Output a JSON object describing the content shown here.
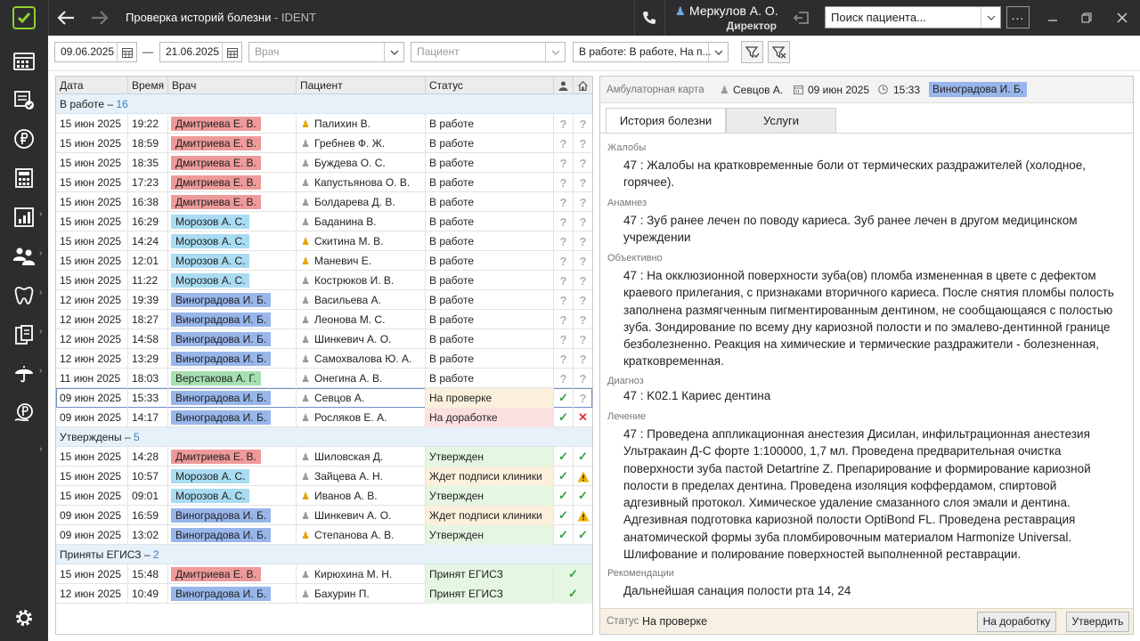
{
  "window": {
    "title": "Проверка историй болезни",
    "app_name": "- IDENT",
    "user_name": "Меркулов А. О.",
    "user_role": "Директор",
    "search_placeholder": "Поиск пациента...",
    "colors": {
      "titlebar": "#2d2d30",
      "sidebar": "#2d2d30",
      "logo": "#8fd12e"
    }
  },
  "sidebar": {
    "items": [
      {
        "icon": "schedule-icon"
      },
      {
        "icon": "tasks-icon"
      },
      {
        "icon": "ruble-icon"
      },
      {
        "icon": "calculator-icon"
      },
      {
        "icon": "reports-icon"
      },
      {
        "icon": "patients-icon"
      },
      {
        "icon": "tooth-icon"
      },
      {
        "icon": "documents-icon"
      },
      {
        "icon": "insurance-icon"
      },
      {
        "icon": "payments-icon"
      },
      {
        "icon": "settings-icon"
      }
    ]
  },
  "filters": {
    "date_from": "09.06.2025",
    "date_to": "21.06.2025",
    "dash": "—",
    "doctor_placeholder": "Врач",
    "patient_placeholder": "Пациент",
    "status_value": "В работе: В работе, На п..."
  },
  "grid": {
    "columns": [
      "Дата",
      "Время",
      "Врач",
      "Пациент",
      "Статус"
    ],
    "groups": [
      {
        "label": "В работе –",
        "count": "16",
        "rows": [
          {
            "date": "15 июн 2025",
            "time": "19:22",
            "doctor": "Дмитриева Е. В.",
            "dc": "red",
            "pi": "gold",
            "patient": "Палихин В.",
            "status": "В работе",
            "sc": "",
            "a": "q",
            "b": "q"
          },
          {
            "date": "15 июн 2025",
            "time": "18:59",
            "doctor": "Дмитриева Е. В.",
            "dc": "red",
            "pi": "gray",
            "patient": "Гребнев Ф. Ж.",
            "status": "В работе",
            "sc": "",
            "a": "q",
            "b": "q"
          },
          {
            "date": "15 июн 2025",
            "time": "18:35",
            "doctor": "Дмитриева Е. В.",
            "dc": "red",
            "pi": "gray",
            "patient": "Буждева О. С.",
            "status": "В работе",
            "sc": "",
            "a": "q",
            "b": "q"
          },
          {
            "date": "15 июн 2025",
            "time": "17:23",
            "doctor": "Дмитриева Е. В.",
            "dc": "red",
            "pi": "gray",
            "patient": "Капустьянова О. В.",
            "status": "В работе",
            "sc": "",
            "a": "q",
            "b": "q"
          },
          {
            "date": "15 июн 2025",
            "time": "16:38",
            "doctor": "Дмитриева Е. В.",
            "dc": "red",
            "pi": "gray",
            "patient": "Болдарева Д. В.",
            "status": "В работе",
            "sc": "",
            "a": "q",
            "b": "q"
          },
          {
            "date": "15 июн 2025",
            "time": "16:29",
            "doctor": "Морозов А. С.",
            "dc": "cyan",
            "pi": "gray",
            "patient": "Баданина В.",
            "status": "В работе",
            "sc": "",
            "a": "q",
            "b": "q"
          },
          {
            "date": "15 июн 2025",
            "time": "14:24",
            "doctor": "Морозов А. С.",
            "dc": "cyan",
            "pi": "gold",
            "patient": "Скитина М. В.",
            "status": "В работе",
            "sc": "",
            "a": "q",
            "b": "q"
          },
          {
            "date": "15 июн 2025",
            "time": "12:01",
            "doctor": "Морозов А. С.",
            "dc": "cyan",
            "pi": "gold",
            "patient": "Маневич Е.",
            "status": "В работе",
            "sc": "",
            "a": "q",
            "b": "q"
          },
          {
            "date": "15 июн 2025",
            "time": "11:22",
            "doctor": "Морозов А. С.",
            "dc": "cyan",
            "pi": "gray",
            "patient": "Кострюков И. В.",
            "status": "В работе",
            "sc": "",
            "a": "q",
            "b": "q"
          },
          {
            "date": "12 июн 2025",
            "time": "19:39",
            "doctor": "Виноградова И. Б.",
            "dc": "blue",
            "pi": "gray",
            "patient": "Васильева А.",
            "status": "В работе",
            "sc": "",
            "a": "q",
            "b": "q"
          },
          {
            "date": "12 июн 2025",
            "time": "18:27",
            "doctor": "Виноградова И. Б.",
            "dc": "blue",
            "pi": "gray",
            "patient": "Леонова М. С.",
            "status": "В работе",
            "sc": "",
            "a": "q",
            "b": "q"
          },
          {
            "date": "12 июн 2025",
            "time": "14:58",
            "doctor": "Виноградова И. Б.",
            "dc": "blue",
            "pi": "gray",
            "patient": "Шинкевич А. О.",
            "status": "В работе",
            "sc": "",
            "a": "q",
            "b": "q"
          },
          {
            "date": "12 июн 2025",
            "time": "13:29",
            "doctor": "Виноградова И. Б.",
            "dc": "blue",
            "pi": "gray",
            "patient": "Самохвалова Ю. А.",
            "status": "В работе",
            "sc": "",
            "a": "q",
            "b": "q"
          },
          {
            "date": "11 июн 2025",
            "time": "18:03",
            "doctor": "Верстакова А. Г.",
            "dc": "green",
            "pi": "gray",
            "patient": "Онегина А. В.",
            "status": "В работе",
            "sc": "",
            "a": "q",
            "b": "q"
          },
          {
            "date": "09 июн 2025",
            "time": "15:33",
            "doctor": "Виноградова И. Б.",
            "dc": "blue",
            "pi": "gray",
            "patient": "Севцов А.",
            "status": "На проверке",
            "sc": "beige",
            "a": "ok",
            "b": "q",
            "selected": true
          },
          {
            "date": "09 июн 2025",
            "time": "14:17",
            "doctor": "Виноградова И. Б.",
            "dc": "blue",
            "pi": "gray",
            "patient": "Росляков Е. А.",
            "status": "На доработке",
            "sc": "pink",
            "a": "ok",
            "b": "no"
          }
        ]
      },
      {
        "label": "Утверждены –",
        "count": "5",
        "rows": [
          {
            "date": "15 июн 2025",
            "time": "14:28",
            "doctor": "Дмитриева Е. В.",
            "dc": "red",
            "pi": "gray",
            "patient": "Шиловская Д.",
            "status": "Утвержден",
            "sc": "lgreen",
            "a": "ok",
            "b": "ok"
          },
          {
            "date": "15 июн 2025",
            "time": "10:57",
            "doctor": "Морозов А. С.",
            "dc": "cyan",
            "pi": "gray",
            "patient": "Зайцева А. Н.",
            "status": "Ждет подписи клиники",
            "sc": "beige",
            "a": "ok",
            "b": "warn"
          },
          {
            "date": "15 июн 2025",
            "time": "09:01",
            "doctor": "Морозов А. С.",
            "dc": "cyan",
            "pi": "gold",
            "patient": "Иванов А. В.",
            "status": "Утвержден",
            "sc": "lgreen",
            "a": "ok",
            "b": "ok"
          },
          {
            "date": "09 июн 2025",
            "time": "16:59",
            "doctor": "Виноградова И. Б.",
            "dc": "blue",
            "pi": "gray",
            "patient": "Шинкевич А. О.",
            "status": "Ждет подписи клиники",
            "sc": "beige",
            "a": "ok",
            "b": "warn"
          },
          {
            "date": "09 июн 2025",
            "time": "13:02",
            "doctor": "Виноградова И. Б.",
            "dc": "blue",
            "pi": "gold",
            "patient": "Степанова А. В.",
            "status": "Утвержден",
            "sc": "lgreen",
            "a": "ok",
            "b": "ok"
          }
        ]
      },
      {
        "label": "Приняты ЕГИСЗ –",
        "count": "2",
        "rows": [
          {
            "date": "15 июн 2025",
            "time": "15:48",
            "doctor": "Дмитриева Е. В.",
            "dc": "red",
            "pi": "gray",
            "patient": "Кирюхина М. Н.",
            "status": "Принят ЕГИСЗ",
            "sc": "lgreen",
            "a": "ok",
            "b": ""
          },
          {
            "date": "12 июн 2025",
            "time": "10:49",
            "doctor": "Виноградова И. Б.",
            "dc": "blue",
            "pi": "gray",
            "patient": "Бахурин П.",
            "status": "Принят ЕГИСЗ",
            "sc": "lgreen",
            "a": "ok",
            "b": ""
          }
        ]
      }
    ],
    "colors": {
      "red": "#ef9a9a",
      "cyan": "#a9dcf2",
      "blue": "#98b6ea",
      "green": "#a6dfb0",
      "beige": "#faf0dc",
      "pink": "#fbe1e1",
      "lgreen": "#e5f6e2"
    }
  },
  "card": {
    "label": "Амбулаторная карта",
    "patient": "Севцов А.",
    "date": "09 июн 2025",
    "time": "15:33",
    "doctor": "Виноградова И. Б.",
    "tabs": [
      "История болезни",
      "Услуги"
    ],
    "sections": [
      {
        "label": "Жалобы",
        "text": "47 : Жалобы на кратковременные боли от термических раздражителей (холодное, горячее)."
      },
      {
        "label": "Анамнез",
        "text": "47 : Зуб ранее лечен по поводу кариеса. Зуб ранее лечен в другом медицинском учреждении"
      },
      {
        "label": "Объективно",
        "text": "47 : На окклюзионной поверхности зуба(ов) пломба измененная в цвете с дефектом краевого прилегания, с признаками вторичного кариеса. После снятия пломбы полость заполнена размягченным пигментированным дентином, не сообщающаяся с полостью зуба. Зондирование по всему дну кариозной полости и по эмалево-дентинной границе безболезненно. Реакция на химические и термические раздражители - болезненная, кратковременная."
      },
      {
        "label": "Диагноз",
        "text": "47 : K02.1 Кариес дентина"
      },
      {
        "label": "Лечение",
        "text": "47 : Проведена аппликационная анестезия Дисилан, инфильтрационная анестезия Ультракаин Д-С  форте 1:100000, 1,7 мл. Проведена предварительная очистка поверхности зуба пастой Detartrine Z. Препарирование и формирование кариозной полости в пределах дентина. Проведена изоляция коффердамом, спиртовой адгезивный протокол. Химическое удаление смазанного слоя эмали и дентина. Адгезивная подготовка кариозной полости OptiBond FL. Проведена реставрация анатомической формы зуба пломбировочным материалом Harmonize Universal. Шлифование и полирование поверхностей выполненной реставрации."
      },
      {
        "label": "Рекомендации",
        "text": "Дальнейшая санация полости рта 14, 24"
      }
    ],
    "status_label": "Статус",
    "status_value": "На проверке",
    "btn_rework": "На доработку",
    "btn_approve": "Утвердить"
  }
}
